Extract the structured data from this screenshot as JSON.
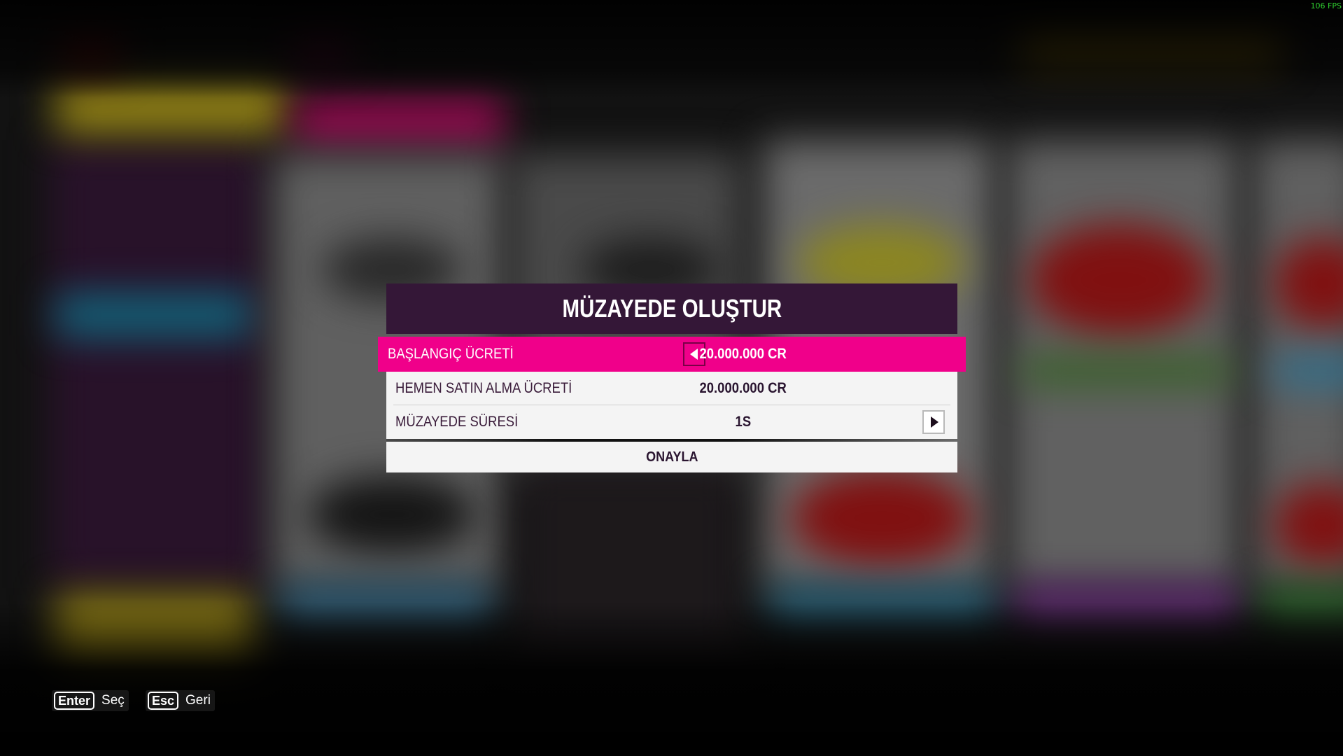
{
  "overlay": {
    "fps_text": "106 FPS"
  },
  "dialog": {
    "title": "MÜZAYEDE OLUŞTUR",
    "rows": [
      {
        "label": "BAŞLANGIÇ ÜCRETİ",
        "value": "20.000.000 CR",
        "selected": true,
        "arrow": "left"
      },
      {
        "label": "HEMEN SATIN ALMA ÜCRETİ",
        "value": "20.000.000 CR",
        "selected": false,
        "arrow": ""
      },
      {
        "label": "MÜZAYEDE SÜRESİ",
        "value": "1S",
        "selected": false,
        "arrow": "right"
      }
    ],
    "confirm_label": "ONAYLA"
  },
  "footer": {
    "hints": [
      {
        "key": "Enter",
        "action": "Seç"
      },
      {
        "key": "Esc",
        "action": "Geri"
      }
    ]
  },
  "colors": {
    "accent_pink": "#f0008a",
    "header_purple": "#341737",
    "row_bg": "#f4f4f4",
    "fps_green": "#2fd12f"
  }
}
